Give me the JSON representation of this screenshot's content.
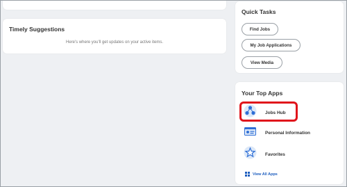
{
  "timely": {
    "title": "Timely Suggestions",
    "message": "Here's where you'll get updates on your active items."
  },
  "quick_tasks": {
    "title": "Quick Tasks",
    "buttons": [
      {
        "label": "Find Jobs"
      },
      {
        "label": "My Job Applications"
      },
      {
        "label": "View Media"
      }
    ]
  },
  "top_apps": {
    "title": "Your Top Apps",
    "apps": [
      {
        "label": "Jobs Hub",
        "icon": "jobs-hub-icon"
      },
      {
        "label": "Personal Information",
        "icon": "personal-information-icon"
      },
      {
        "label": "Favorites",
        "icon": "favorites-icon"
      }
    ],
    "view_all": "View All Apps",
    "highlight_color": "#e0131b"
  }
}
